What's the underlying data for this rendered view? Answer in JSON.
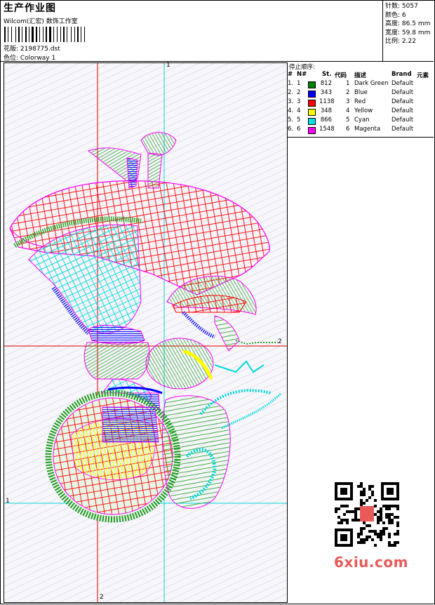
{
  "header": {
    "title": "生产作业图",
    "company": "Wilcom(汇宏) 数饰工作室",
    "file_label": "花版:",
    "file_value": "2198775.dst",
    "colorway_label": "色位:",
    "colorway_value": "Colorway 1"
  },
  "stats": {
    "stitches_label": "针数:",
    "stitches_value": "5057",
    "colors_label": "颜色:",
    "colors_value": "6",
    "height_label": "高度:",
    "height_value": "86.5 mm",
    "width_label": "宽度:",
    "width_value": "59.8 mm",
    "scale_label": "比例:",
    "scale_value": "2.22"
  },
  "sequence": {
    "title": "停止顺序:",
    "columns": [
      "#",
      "N#",
      "St.",
      "代码",
      "描述",
      "Brand",
      "元素"
    ],
    "rows": [
      {
        "num": "1.",
        "n": "1",
        "color": "#008000",
        "stitches": "812",
        "code": "1",
        "desc": "Dark Green",
        "brand": "Default"
      },
      {
        "num": "2.",
        "n": "2",
        "color": "#0000ff",
        "stitches": "343",
        "code": "2",
        "desc": "Blue",
        "brand": "Default"
      },
      {
        "num": "3.",
        "n": "3",
        "color": "#ff0000",
        "stitches": "1138",
        "code": "3",
        "desc": "Red",
        "brand": "Default"
      },
      {
        "num": "4.",
        "n": "4",
        "color": "#ffff00",
        "stitches": "348",
        "code": "4",
        "desc": "Yellow",
        "brand": "Default"
      },
      {
        "num": "5.",
        "n": "5",
        "color": "#00e0e0",
        "stitches": "866",
        "code": "5",
        "desc": "Cyan",
        "brand": "Default"
      },
      {
        "num": "6.",
        "n": "6",
        "color": "#ff00ff",
        "stitches": "1548",
        "code": "6",
        "desc": "Magenta",
        "brand": "Default"
      }
    ]
  },
  "axes": {
    "top_label": "1",
    "right_label": "2",
    "left_label": "1",
    "bottom_label": "2"
  },
  "watermark": "6xiu.com"
}
